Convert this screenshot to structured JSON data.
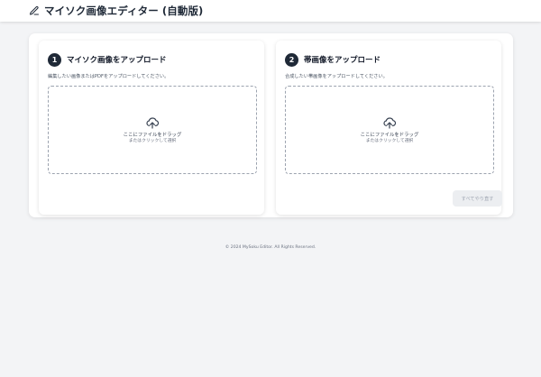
{
  "header": {
    "title": "マイソク画像エディター (自動版)",
    "icon": "pencil-icon"
  },
  "panels": [
    {
      "step": "1",
      "title": "マイソク画像をアップロード",
      "description": "編集したい画像またはPDFをアップロードしてください。",
      "dropzone": {
        "icon": "upload-cloud-icon",
        "main_text": "ここにファイルをドラッグ",
        "sub_text": "またはクリックして選択"
      }
    },
    {
      "step": "2",
      "title": "帯画像をアップロード",
      "description": "合成したい帯画像をアップロードしてください。",
      "dropzone": {
        "icon": "upload-cloud-icon",
        "main_text": "ここにファイルをドラッグ",
        "sub_text": "またはクリックして選択"
      }
    }
  ],
  "actions": {
    "reset_label": "すべてやり直す"
  },
  "footer": {
    "copyright": "© 2024 MySoku Editor. All Rights Reserved."
  },
  "colors": {
    "background": "#f3f4f6",
    "badge": "#1f2937",
    "dropzone_border": "#9ca3af",
    "disabled_button": "#eceef1"
  }
}
